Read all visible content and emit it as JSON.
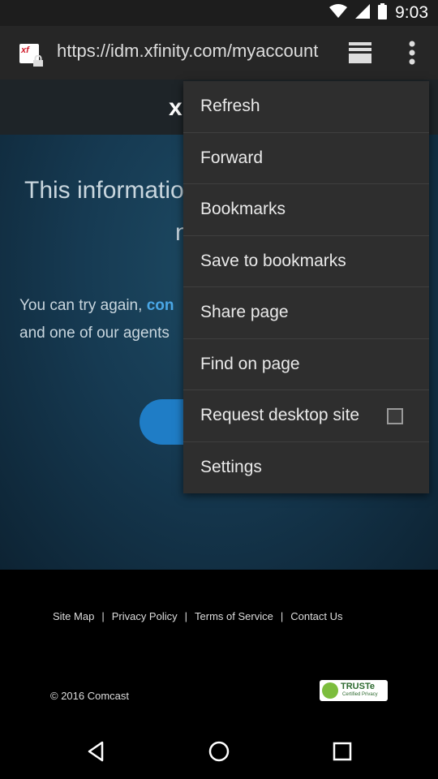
{
  "status_bar": {
    "time": "9:03"
  },
  "browser": {
    "url": "https://idm.xfinity.com/myaccount",
    "favicon_label": "xf"
  },
  "site": {
    "logo_letter": "x"
  },
  "page": {
    "heading_line1": "This information",
    "heading_line2": "n",
    "text_line1_prefix": "You can try again, ",
    "text_line1_link": "con",
    "text_line2": "and one of our agents"
  },
  "footer": {
    "links": [
      "Site Map",
      "|",
      "Privacy Policy",
      "|",
      "Terms of Service",
      "|",
      "Contact Us"
    ],
    "copyright": "© 2016 Comcast",
    "badge_text": "TRUSTe",
    "badge_subtext": "Certified Privacy"
  },
  "menu": {
    "items": [
      {
        "label": "Refresh"
      },
      {
        "label": "Forward"
      },
      {
        "label": "Bookmarks"
      },
      {
        "label": "Save to bookmarks"
      },
      {
        "label": "Share page"
      },
      {
        "label": "Find on page"
      },
      {
        "label": "Request desktop site",
        "checked": false
      },
      {
        "label": "Settings"
      }
    ]
  }
}
